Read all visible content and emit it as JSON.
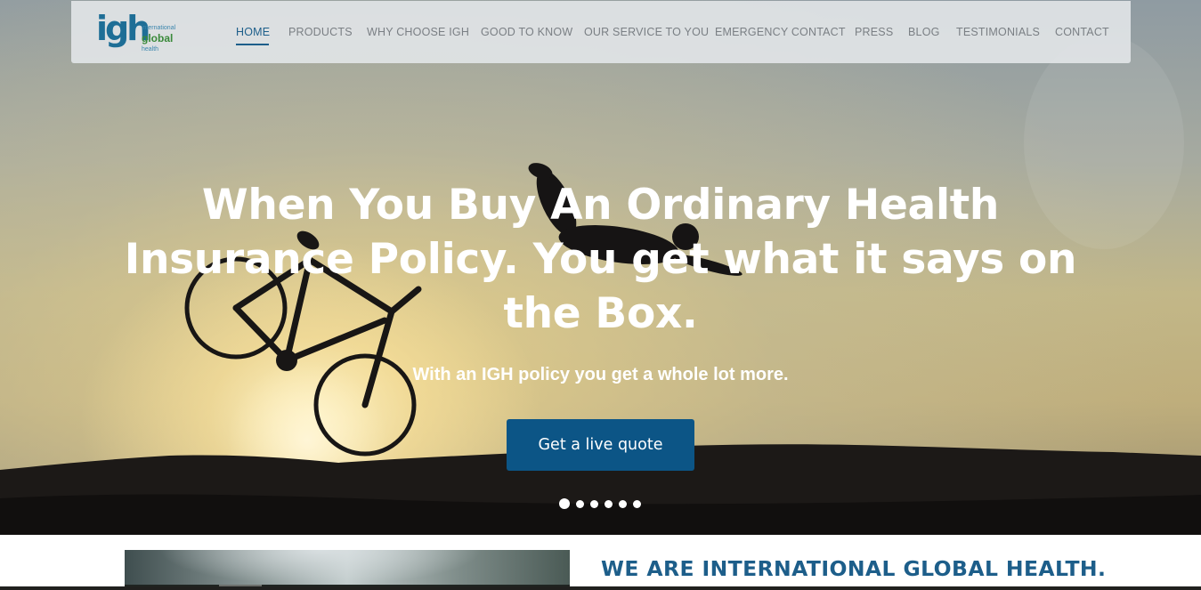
{
  "brand": {
    "logo_letters": "igh",
    "logo_line1": "international",
    "logo_line2": "global",
    "logo_line3": "health"
  },
  "nav": {
    "items": [
      {
        "label": "HOME",
        "active": true
      },
      {
        "label": "PRODUCTS"
      },
      {
        "label": "WHY CHOOSE IGH"
      },
      {
        "label": "GOOD TO KNOW"
      },
      {
        "label": "OUR SERVICE TO YOU"
      },
      {
        "label": "EMERGENCY CONTACT"
      },
      {
        "label": "PRESS"
      },
      {
        "label": "BLOG"
      },
      {
        "label": "TESTIMONIALS"
      },
      {
        "label": "CONTACT"
      }
    ]
  },
  "hero": {
    "headline_line1": "When You Buy An Ordinary Health",
    "headline_line2": "Insurance Policy. You get what it says on",
    "headline_line3": "the Box.",
    "subheadline": "With an IGH policy you get a whole lot more.",
    "cta_label": "Get a live quote",
    "slides_total": 6,
    "active_slide": 1
  },
  "about": {
    "title": "WE ARE INTERNATIONAL GLOBAL HEALTH."
  },
  "colors": {
    "accent": "#1d5e8a",
    "cta_background": "#0c5586",
    "nav_text": "#7a7f84",
    "logo_green": "#3a8a3a"
  },
  "icons": {
    "slider_dot": "circle"
  }
}
